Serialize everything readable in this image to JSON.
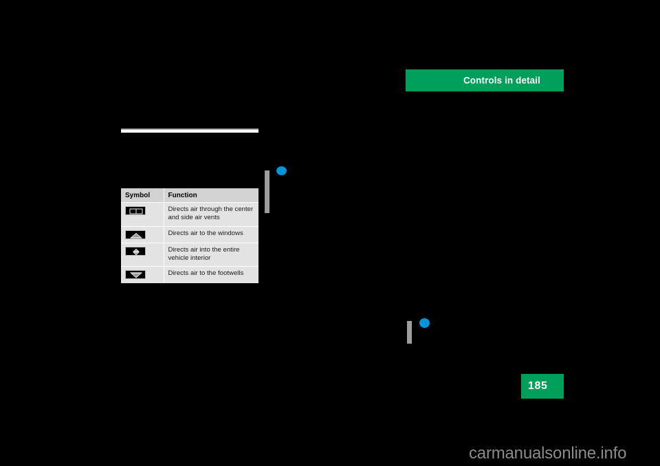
{
  "document": {
    "background_color": "#000000",
    "section_banner": {
      "label": "Controls in detail",
      "color": "#00A05A",
      "text_color": "#FFFFFF"
    },
    "page_number": {
      "value": "185",
      "color": "#00A05A",
      "text_color": "#FFFFFF"
    },
    "watermark": {
      "text": "carmanualsonline.info",
      "color": "#8C8C8C"
    },
    "change_markers": [
      {
        "name": "marker-a",
        "bar_color": "#9E9E9E",
        "dot_color": "#0095DA"
      },
      {
        "name": "marker-b",
        "bar_color": "#9E9E9E",
        "dot_color": "#0095DA"
      }
    ]
  },
  "symbol_table": {
    "header": {
      "symbol": "Symbol",
      "function": "Function"
    },
    "rows": [
      {
        "icon": "center-and-side-vents-icon",
        "function": "Directs air through the center and side air vents"
      },
      {
        "icon": "windshield-defrost-vent-icon",
        "function": "Directs air to the windows"
      },
      {
        "icon": "bi-level-vent-icon",
        "function": "Directs air into the entire vehicle interior"
      },
      {
        "icon": "footwell-vent-icon",
        "function": "Directs air to the footwells"
      }
    ]
  }
}
